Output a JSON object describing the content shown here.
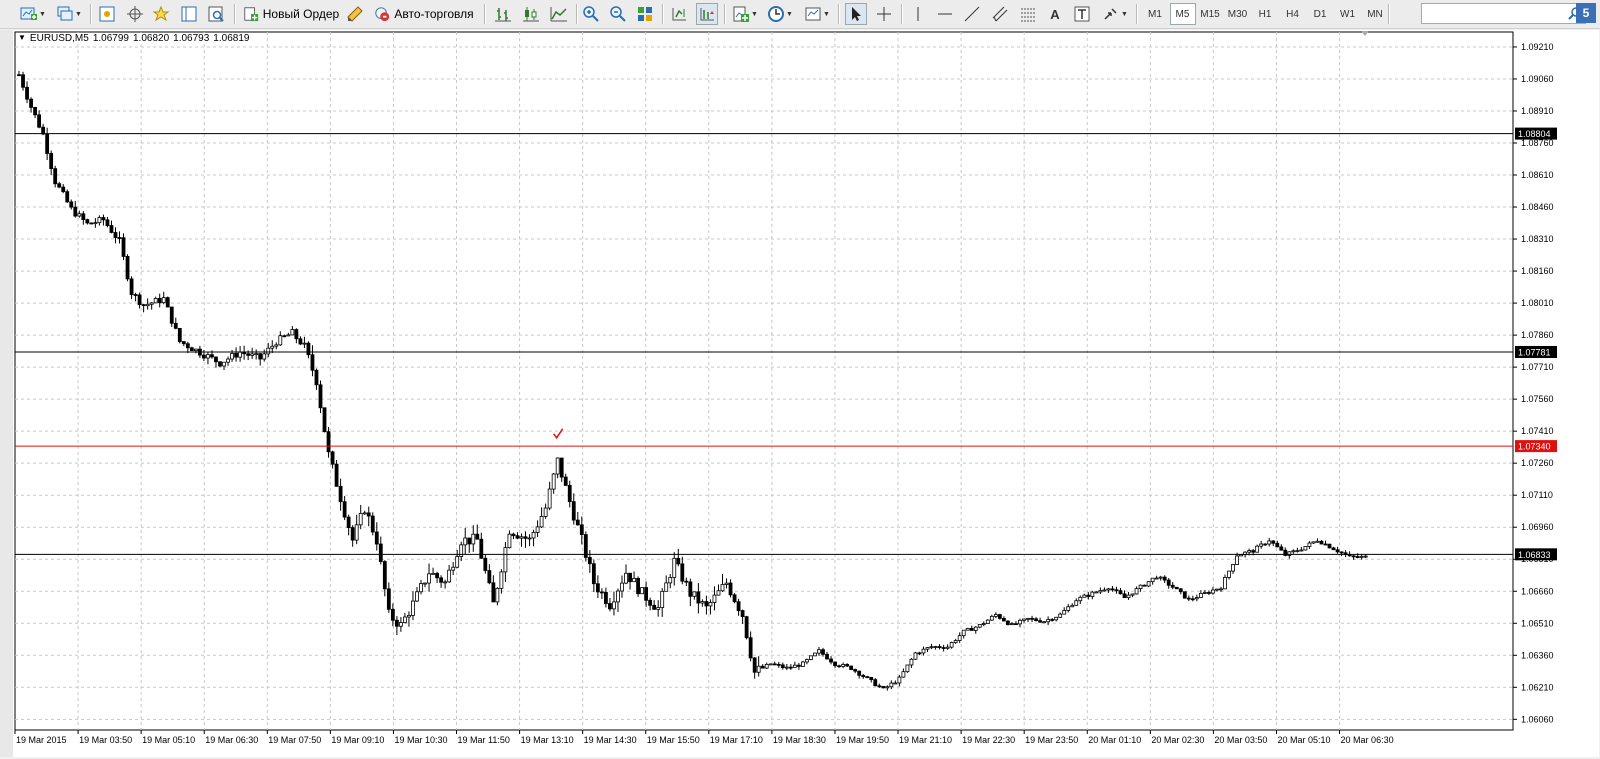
{
  "toolbar": {
    "new_order_label": "Новый Ордер",
    "autotrading_label": "Авто-торговля",
    "timeframes": [
      "M1",
      "M5",
      "M15",
      "M30",
      "H1",
      "H4",
      "D1",
      "W1",
      "MN"
    ],
    "active_timeframe": "M5",
    "search_placeholder": "",
    "badge_text": "5",
    "icons": [
      "new-chart-icon",
      "profiles-icon",
      "market-watch-icon",
      "navigator-icon",
      "favorites-icon",
      "data-window-icon",
      "tester-icon",
      "metaeditor-icon",
      "bar-chart-icon",
      "candlestick-icon",
      "line-chart-icon",
      "zoom-in-icon",
      "zoom-out-icon",
      "tile-windows-icon",
      "chart-shift-icon",
      "autoscroll-icon",
      "indicators-icon",
      "periods-icon",
      "templates-icon",
      "cursor-icon",
      "crosshair-icon",
      "vertical-line-icon",
      "horizontal-line-icon",
      "trendline-icon",
      "equidistant-channel-icon",
      "fibonacci-icon",
      "text-icon",
      "text-label-icon",
      "arrows-icon"
    ]
  },
  "chart": {
    "symbol": "EURUSD,M5",
    "ohlc": [
      "1.06799",
      "1.06820",
      "1.06793",
      "1.06819"
    ],
    "price_labels": [
      "1.09210",
      "1.09060",
      "1.08910",
      "1.08760",
      "1.08610",
      "1.08460",
      "1.08310",
      "1.08160",
      "1.08010",
      "1.07860",
      "1.07710",
      "1.07560",
      "1.07410",
      "1.07260",
      "1.07110",
      "1.06960",
      "1.06810",
      "1.06660",
      "1.06510",
      "1.06360",
      "1.06210",
      "1.06060"
    ],
    "time_labels": [
      "19 Mar 2015",
      "19 Mar 03:50",
      "19 Mar 05:10",
      "19 Mar 06:30",
      "19 Mar 07:50",
      "19 Mar 09:10",
      "19 Mar 10:30",
      "19 Mar 11:50",
      "19 Mar 13:10",
      "19 Mar 14:30",
      "19 Mar 15:50",
      "19 Mar 17:10",
      "19 Mar 18:30",
      "19 Mar 19:50",
      "19 Mar 21:10",
      "19 Mar 22:30",
      "19 Mar 23:50",
      "20 Mar 01:10",
      "20 Mar 02:30",
      "20 Mar 03:50",
      "20 Mar 05:10",
      "20 Mar 06:30"
    ],
    "hlines": [
      {
        "price": 1.08804,
        "label": "1.08804",
        "color": "#000000"
      },
      {
        "price": 1.07781,
        "label": "1.07781",
        "color": "#000000"
      },
      {
        "price": 1.0734,
        "label": "1.07340",
        "color": "#e01010"
      },
      {
        "price": 1.06833,
        "label": "1.06833",
        "color": "#000000"
      }
    ],
    "colors": {
      "grid": "#c8c8c8",
      "candle": "#000000",
      "bg": "#ffffff",
      "accent_red": "#e01010"
    }
  },
  "chart_data": {
    "type": "candlestick",
    "symbol": "EURUSD",
    "timeframe": "M5",
    "title": "EURUSD,M5",
    "ylim": [
      1.0601,
      1.0928
    ],
    "x_ticks": [
      "19 Mar 2015",
      "19 Mar 03:50",
      "19 Mar 05:10",
      "19 Mar 06:30",
      "19 Mar 07:50",
      "19 Mar 09:10",
      "19 Mar 10:30",
      "19 Mar 11:50",
      "19 Mar 13:10",
      "19 Mar 14:30",
      "19 Mar 15:50",
      "19 Mar 17:10",
      "19 Mar 18:30",
      "19 Mar 19:50",
      "19 Mar 21:10",
      "19 Mar 22:30",
      "19 Mar 23:50",
      "20 Mar 01:10",
      "20 Mar 02:30",
      "20 Mar 03:50",
      "20 Mar 05:10",
      "20 Mar 06:30"
    ],
    "close_path": [
      [
        0,
        1.0908
      ],
      [
        3,
        1.0893
      ],
      [
        6,
        1.088
      ],
      [
        9,
        1.0858
      ],
      [
        13,
        1.0845
      ],
      [
        17,
        1.0838
      ],
      [
        21,
        1.084
      ],
      [
        25,
        1.083
      ],
      [
        28,
        1.0806
      ],
      [
        31,
        1.08
      ],
      [
        36,
        1.0803
      ],
      [
        40,
        1.0783
      ],
      [
        45,
        1.0778
      ],
      [
        50,
        1.0773
      ],
      [
        55,
        1.0778
      ],
      [
        60,
        1.0775
      ],
      [
        64,
        1.0783
      ],
      [
        68,
        1.0787
      ],
      [
        71,
        1.078
      ],
      [
        74,
        1.0765
      ],
      [
        77,
        1.073
      ],
      [
        80,
        1.071
      ],
      [
        83,
        1.069
      ],
      [
        86,
        1.0705
      ],
      [
        89,
        1.069
      ],
      [
        92,
        1.0655
      ],
      [
        95,
        1.065
      ],
      [
        98,
        1.066
      ],
      [
        102,
        1.0675
      ],
      [
        106,
        1.067
      ],
      [
        110,
        1.069
      ],
      [
        114,
        1.069
      ],
      [
        118,
        1.066
      ],
      [
        122,
        1.0695
      ],
      [
        127,
        1.069
      ],
      [
        131,
        1.0705
      ],
      [
        134,
        1.0727
      ],
      [
        137,
        1.0708
      ],
      [
        140,
        1.069
      ],
      [
        143,
        1.067
      ],
      [
        147,
        1.066
      ],
      [
        151,
        1.0675
      ],
      [
        155,
        1.0665
      ],
      [
        159,
        1.0658
      ],
      [
        163,
        1.068
      ],
      [
        167,
        1.0665
      ],
      [
        171,
        1.0658
      ],
      [
        176,
        1.067
      ],
      [
        180,
        1.0655
      ],
      [
        183,
        1.0628
      ],
      [
        187,
        1.0632
      ],
      [
        191,
        1.063
      ],
      [
        195,
        1.0632
      ],
      [
        199,
        1.0638
      ],
      [
        203,
        1.0632
      ],
      [
        207,
        1.063
      ],
      [
        211,
        1.0625
      ],
      [
        215,
        1.062
      ],
      [
        219,
        1.0625
      ],
      [
        223,
        1.0637
      ],
      [
        227,
        1.064
      ],
      [
        231,
        1.064
      ],
      [
        235,
        1.0647
      ],
      [
        239,
        1.065
      ],
      [
        243,
        1.0655
      ],
      [
        247,
        1.065
      ],
      [
        251,
        1.0653
      ],
      [
        255,
        1.0652
      ],
      [
        259,
        1.0655
      ],
      [
        263,
        1.0662
      ],
      [
        267,
        1.0665
      ],
      [
        271,
        1.0668
      ],
      [
        275,
        1.0663
      ],
      [
        279,
        1.0668
      ],
      [
        283,
        1.0673
      ],
      [
        287,
        1.0668
      ],
      [
        291,
        1.0662
      ],
      [
        295,
        1.0665
      ],
      [
        299,
        1.0668
      ],
      [
        303,
        1.0683
      ],
      [
        307,
        1.0685
      ],
      [
        311,
        1.069
      ],
      [
        315,
        1.0683
      ],
      [
        319,
        1.0686
      ],
      [
        323,
        1.069
      ],
      [
        327,
        1.0686
      ],
      [
        331,
        1.0682
      ],
      [
        335,
        1.0682
      ]
    ],
    "markers": [
      {
        "time": "19 Mar 13:10",
        "price": 1.0736,
        "symbol": "check",
        "color": "#e01010"
      }
    ],
    "horizontal_levels": [
      1.08804,
      1.07781,
      1.0734,
      1.06833
    ]
  }
}
